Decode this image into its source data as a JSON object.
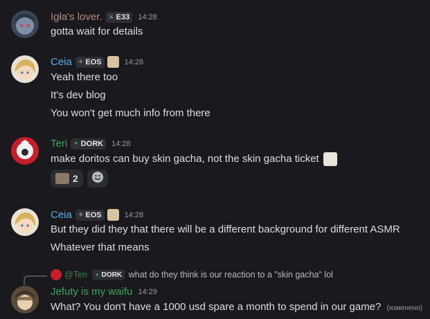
{
  "messages": [
    {
      "author": "Igła's lover.",
      "author_color": "#b08a7a",
      "tag": "E33",
      "tag_icon": "sword-icon",
      "time": "14:28",
      "lines": [
        "gotta wait for details"
      ]
    },
    {
      "author": "Ceia",
      "author_color": "#4fb3e8",
      "tag": "EOS",
      "tag_icon": "sparkle-icon",
      "time": "14:28",
      "lines": [
        "Yeah there too",
        "It's dev blog",
        "You won't get much info from there"
      ]
    },
    {
      "author": "Teri",
      "author_color": "#3ba55d",
      "tag": "DORK",
      "tag_icon": "sparkle-icon",
      "time": "14:28",
      "lines": [
        "make doritos can buy skin gacha, not the skin gacha ticket"
      ],
      "reactions": [
        {
          "emoji": "anime-face-emoji",
          "count": "2"
        }
      ]
    },
    {
      "author": "Ceia",
      "author_color": "#4fb3e8",
      "tag": "EOS",
      "tag_icon": "sparkle-icon",
      "time": "14:28",
      "lines": [
        "But they did they that there will be a different background for different ASMR",
        "Whatever that means"
      ]
    },
    {
      "reply": {
        "author": "@Teri",
        "tag": "DORK",
        "text": "what do they think is our reaction to a \"skin gacha\" lol"
      },
      "author": "Jefuty is my waifu",
      "author_color": "#3ba55d",
      "time": "14:29",
      "lines": [
        "What? You don't have a 1000 usd spare a month to spend in our game?"
      ],
      "edited": "(изменено)"
    }
  ]
}
